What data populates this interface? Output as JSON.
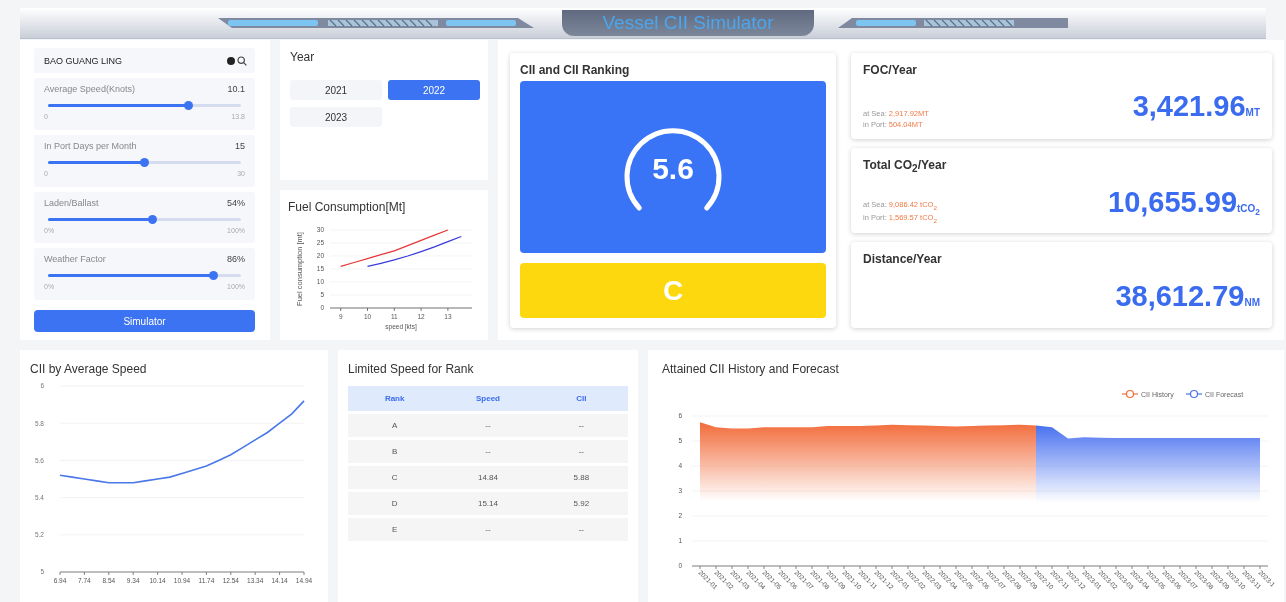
{
  "header": {
    "title": "Vessel CII Simulator"
  },
  "vessel_search": {
    "value": "BAO GUANG LING"
  },
  "sliders": [
    {
      "label": "Average Speed(Knots)",
      "reading": "10.1",
      "min": "0",
      "max": "13.8",
      "level": 0.73
    },
    {
      "label": "In Port Days per Month",
      "reading": "15",
      "min": "0",
      "max": "30",
      "level": 0.5
    },
    {
      "label": "Laden/Ballast",
      "reading": "54%",
      "min": "0%",
      "max": "100%",
      "level": 0.54
    },
    {
      "label": "Weather Factor",
      "reading": "86%",
      "min": "0%",
      "max": "100%",
      "level": 0.86
    }
  ],
  "simulate_button": "Simulator",
  "year": {
    "title": "Year",
    "options": [
      {
        "label": "2021",
        "selected": false
      },
      {
        "label": "2022",
        "selected": true
      },
      {
        "label": "2023",
        "selected": false
      }
    ]
  },
  "fuel_consumption": {
    "title": "Fuel Consumption[Mt]",
    "chart_data": {
      "type": "line",
      "xlabel": "speed [kts]",
      "ylabel": "Fuel consumption [mt]",
      "x": [
        9,
        9.5,
        10,
        10.5,
        11,
        11.5,
        12,
        12.5,
        13,
        13.5
      ],
      "series": [
        {
          "color": "#e8383b",
          "values": [
            16,
            17.5,
            19,
            20.5,
            22,
            24,
            26,
            28,
            30,
            null
          ]
        },
        {
          "color": "#3b3bdc",
          "values": [
            null,
            null,
            16,
            17.2,
            18.5,
            20,
            21.7,
            23.5,
            25.5,
            27.5
          ]
        }
      ],
      "grid": true,
      "xlim": [
        8.6,
        13.9
      ],
      "ylim": [
        0,
        30
      ],
      "xticks": [
        9,
        10,
        11,
        12,
        13
      ],
      "yticks": [
        0,
        5,
        10,
        15,
        20,
        25,
        30
      ]
    }
  },
  "cii_ranking": {
    "title": "CII and CII Ranking",
    "cii_value": "5.6",
    "rank": "C"
  },
  "stats": [
    {
      "title": "FOC/Year",
      "value": "3,421.96",
      "unit": "MT",
      "breakdown": [
        {
          "label": "at Sea:",
          "value": "2,917.92MT"
        },
        {
          "label": "in Port:",
          "value": "504.04MT"
        }
      ]
    },
    {
      "title": "Total CO$_{2}$/Year",
      "value": "10,655.99",
      "unit": "tCO$_{2}$",
      "breakdown": [
        {
          "label": "at Sea:",
          "value": "9,086.42 tCO$_{2}$"
        },
        {
          "label": "in Port:",
          "value": "1,569.57 tCO$_{2}$"
        }
      ]
    },
    {
      "title": "Distance/Year",
      "value": "38,612.79",
      "unit": "NM"
    }
  ],
  "cii_by_speed": {
    "title": "CII by Average Speed",
    "chart_data": {
      "type": "line",
      "x": [
        6.94,
        7.34,
        7.74,
        8.14,
        8.54,
        8.94,
        9.34,
        9.74,
        10.14,
        10.54,
        10.94,
        11.34,
        11.74,
        12.14,
        12.54,
        12.94,
        13.34,
        13.74,
        14.14,
        14.54,
        14.94
      ],
      "series": [
        {
          "color": "#4a78e8",
          "values": [
            5.52,
            5.51,
            5.5,
            5.49,
            5.48,
            5.48,
            5.48,
            5.49,
            5.5,
            5.51,
            5.53,
            5.55,
            5.57,
            5.6,
            5.63,
            5.67,
            5.71,
            5.75,
            5.8,
            5.85,
            5.92
          ]
        }
      ],
      "grid": true,
      "xlim": [
        6.94,
        14.94
      ],
      "ylim": [
        5,
        6
      ],
      "xticks": [
        6.94,
        7.74,
        8.54,
        9.34,
        10.14,
        10.94,
        11.74,
        12.54,
        13.34,
        14.14,
        14.94
      ],
      "yticks": [
        5,
        5.2,
        5.4,
        5.6,
        5.8,
        6
      ]
    }
  },
  "limited_speed": {
    "title": "Limited Speed for Rank",
    "columns": [
      "Rank",
      "Speed",
      "CII"
    ],
    "rows": [
      [
        "A",
        "--",
        "--"
      ],
      [
        "B",
        "--",
        "--"
      ],
      [
        "C",
        "14.84",
        "5.88"
      ],
      [
        "D",
        "15.14",
        "5.92"
      ],
      [
        "E",
        "--",
        "--"
      ]
    ]
  },
  "cii_history": {
    "title": "Attained CII History and Forecast",
    "chart_data": {
      "type": "area",
      "categories": [
        "2021-01",
        "2021-02",
        "2021-03",
        "2021-04",
        "2021-05",
        "2021-06",
        "2021-07",
        "2021-08",
        "2021-09",
        "2021-10",
        "2021-11",
        "2021-12",
        "2022-01",
        "2022-02",
        "2022-03",
        "2022-04",
        "2022-05",
        "2022-06",
        "2022-07",
        "2022-08",
        "2022-09",
        "2022-10",
        "2022-11",
        "2022-12",
        "2023-01",
        "2023-02",
        "2023-03",
        "2023-04",
        "2023-05",
        "2023-06",
        "2023-07",
        "2023-08",
        "2023-09",
        "2023-10",
        "2023-11",
        "2023-1"
      ],
      "series": [
        {
          "name": "CII History",
          "color": "#f26b3a",
          "values": [
            5.75,
            5.55,
            5.5,
            5.5,
            5.55,
            5.55,
            5.55,
            5.55,
            5.6,
            5.6,
            5.6,
            5.62,
            5.65,
            5.63,
            5.62,
            5.6,
            5.58,
            5.6,
            5.62,
            5.63,
            5.65,
            5.62,
            null,
            null,
            null,
            null,
            null,
            null,
            null,
            null,
            null,
            null,
            null,
            null,
            null,
            null
          ]
        },
        {
          "name": "CII Forecast",
          "color": "#4a72f0",
          "values": [
            null,
            null,
            null,
            null,
            null,
            null,
            null,
            null,
            null,
            null,
            null,
            null,
            null,
            null,
            null,
            null,
            null,
            null,
            null,
            null,
            null,
            5.62,
            5.55,
            5.1,
            5.15,
            5.13,
            5.12,
            5.12,
            5.12,
            5.12,
            5.12,
            5.12,
            5.12,
            5.12,
            5.12,
            5.12
          ]
        }
      ],
      "grid": true,
      "legend": true,
      "ylim": [
        0,
        6
      ],
      "yticks": [
        0,
        1,
        2,
        3,
        4,
        5,
        6
      ]
    }
  }
}
